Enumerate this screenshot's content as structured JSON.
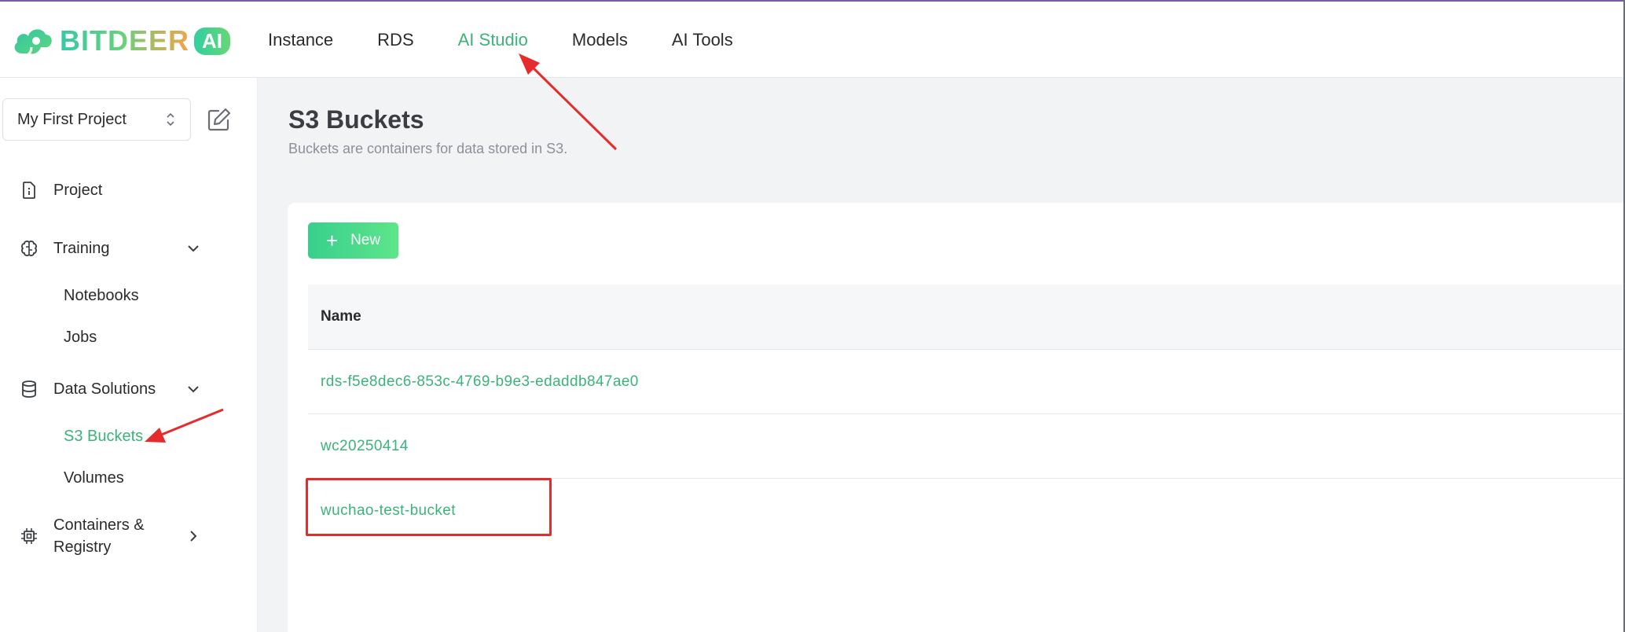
{
  "brand": {
    "name": "BITDEER",
    "badge": "AI"
  },
  "nav": {
    "items": [
      {
        "label": "Instance"
      },
      {
        "label": "RDS"
      },
      {
        "label": "AI Studio"
      },
      {
        "label": "Models"
      },
      {
        "label": "AI Tools"
      }
    ],
    "active": "AI Studio"
  },
  "sidebar": {
    "project_select": "My First Project",
    "items": [
      {
        "label": "Project",
        "icon": "project-info-icon"
      },
      {
        "label": "Training",
        "icon": "brain-icon",
        "expanded": true,
        "children": [
          {
            "label": "Notebooks"
          },
          {
            "label": "Jobs"
          }
        ]
      },
      {
        "label": "Data Solutions",
        "icon": "database-icon",
        "expanded": true,
        "children": [
          {
            "label": "S3 Buckets",
            "active": true
          },
          {
            "label": "Volumes"
          }
        ]
      },
      {
        "label": "Containers & Registry",
        "icon": "chip-icon",
        "expanded": false
      }
    ]
  },
  "main": {
    "title": "S3 Buckets",
    "subtitle": "Buckets are containers for data stored in S3.",
    "new_button": "New",
    "table": {
      "header": "Name",
      "rows": [
        "rds-f5e8dec6-853c-4769-b9e3-edaddb847ae0",
        "wc20250414",
        "wuchao-test-bucket"
      ]
    }
  },
  "colors": {
    "accent": "#3bb37b",
    "annotation": "#e52b2b"
  }
}
